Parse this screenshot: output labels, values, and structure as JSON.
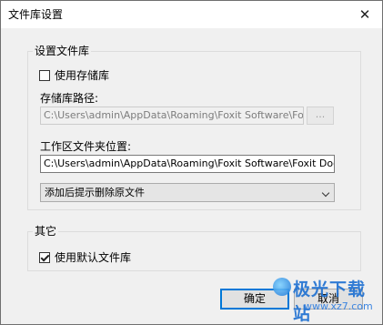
{
  "window": {
    "title": "文件库设置"
  },
  "repo_group": {
    "label": "设置文件库",
    "use_repo_label": "使用存储库",
    "use_repo_checked": false,
    "path_label": "存储库路径:",
    "path_value": "C:\\Users\\admin\\AppData\\Roaming\\Foxit Software\\Foxit Do",
    "browse_label": "...",
    "workspace_label": "工作区文件夹位置:",
    "workspace_value": "C:\\Users\\admin\\AppData\\Roaming\\Foxit Software\\Foxit Document",
    "after_add_option": "添加后提示删除原文件"
  },
  "other_group": {
    "label": "其它",
    "default_repo_label": "使用默认文件库",
    "default_repo_checked": true
  },
  "buttons": {
    "ok": "确定",
    "cancel": "取消"
  },
  "watermark": {
    "brand": "极光下载站",
    "url": "www.xz7.com"
  },
  "icons": {
    "close": "close-icon",
    "dropdown": "chevron-down-icon",
    "checkbox": "checkmark-icon"
  }
}
